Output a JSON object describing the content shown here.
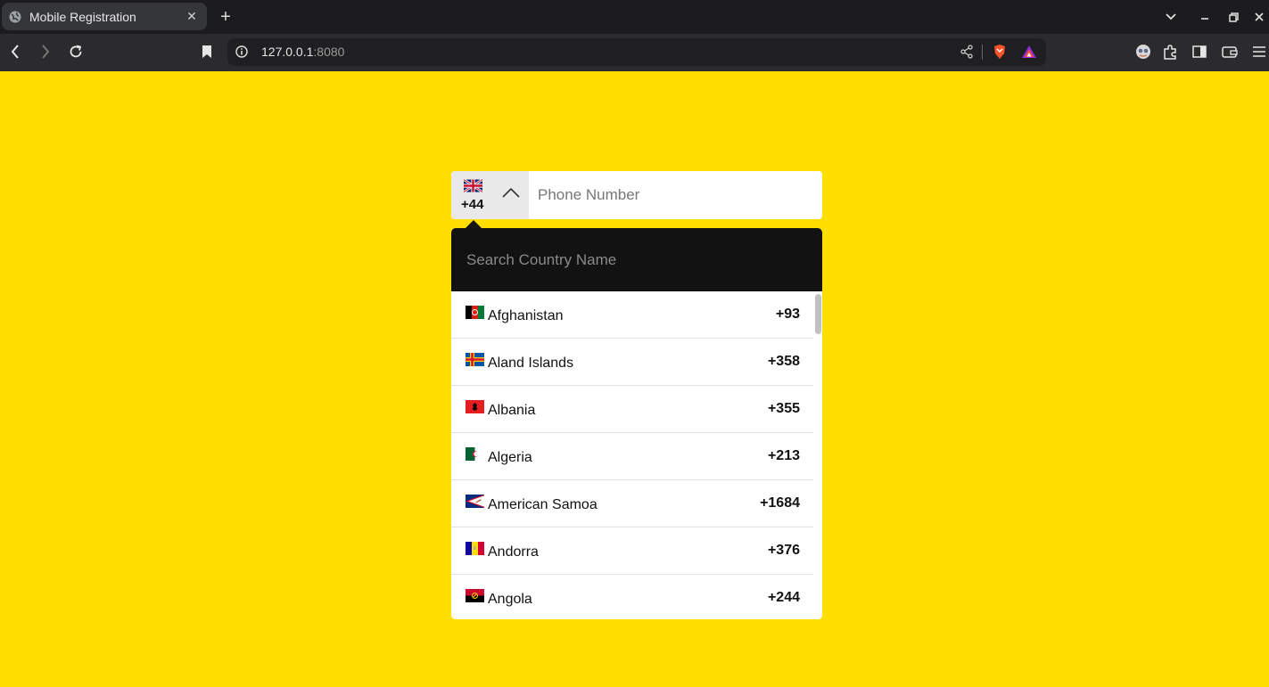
{
  "browser": {
    "tab_title": "Mobile Registration",
    "url_host": "127.0.0.1",
    "url_port": ":8080"
  },
  "phone": {
    "selected_flag": "gb-flag",
    "selected_code": "+44",
    "placeholder": "Phone Number",
    "value": ""
  },
  "search": {
    "placeholder": "Search Country Name",
    "value": ""
  },
  "countries": [
    {
      "name": "Afghanistan",
      "dial": "+93",
      "flag": "af-flag"
    },
    {
      "name": "Aland Islands",
      "dial": "+358",
      "flag": "ax-flag"
    },
    {
      "name": "Albania",
      "dial": "+355",
      "flag": "al-flag"
    },
    {
      "name": "Algeria",
      "dial": "+213",
      "flag": "dz-flag"
    },
    {
      "name": "American Samoa",
      "dial": "+1684",
      "flag": "as-flag"
    },
    {
      "name": "Andorra",
      "dial": "+376",
      "flag": "ad-flag"
    },
    {
      "name": "Angola",
      "dial": "+244",
      "flag": "ao-flag"
    }
  ],
  "colors": {
    "page_background": "#ffde00",
    "search_background": "#121212"
  }
}
